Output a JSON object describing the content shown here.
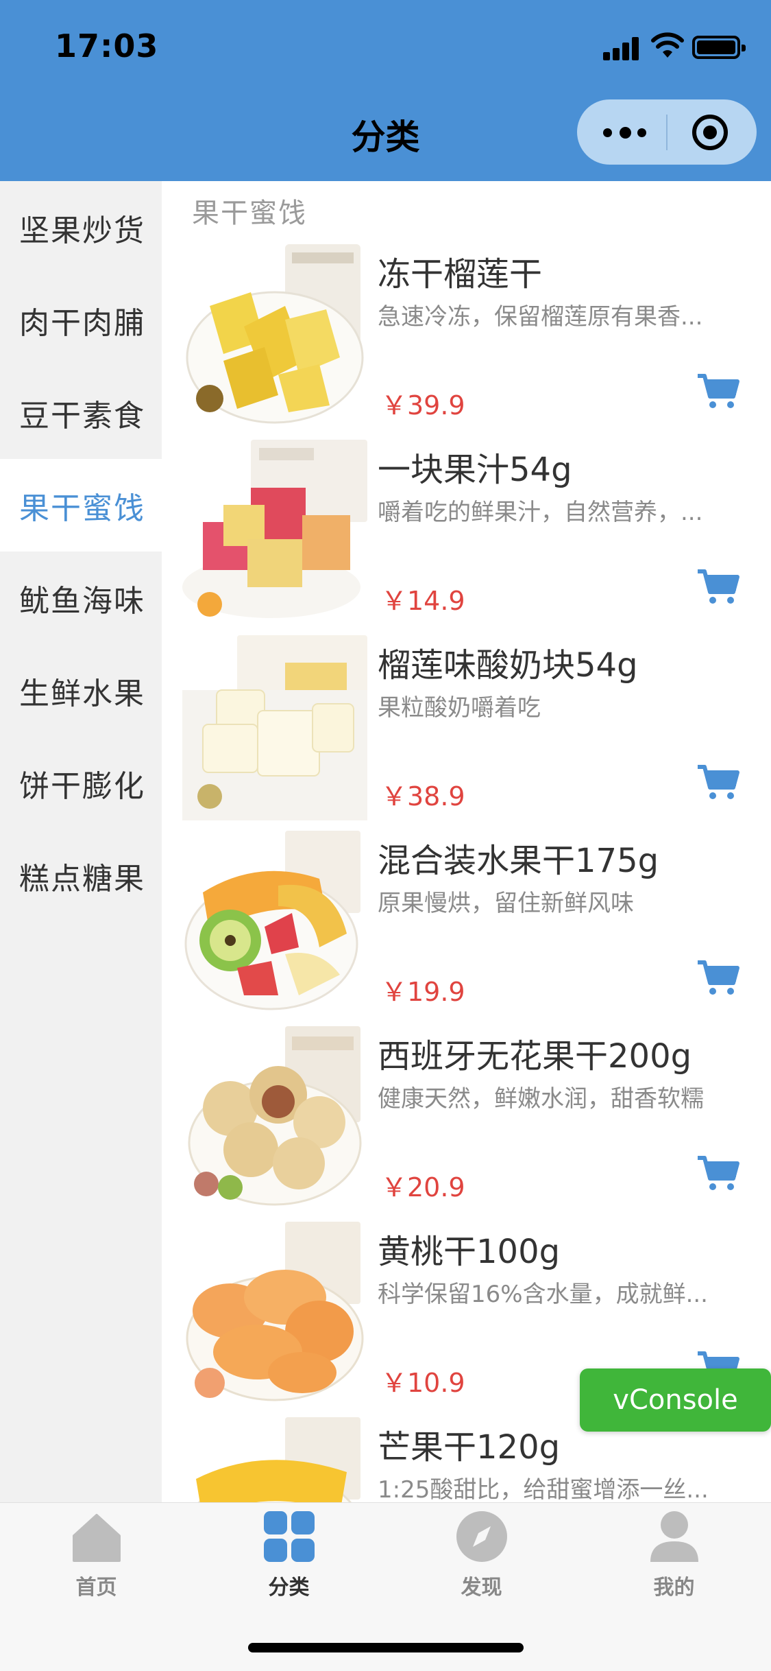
{
  "status_bar": {
    "time": "17:03"
  },
  "nav": {
    "title": "分类"
  },
  "colors": {
    "accent": "#4a90d5",
    "price": "#e0443f",
    "vconsole": "#40b63a"
  },
  "sidebar": {
    "items": [
      {
        "label": "坚果炒货",
        "active": false
      },
      {
        "label": "肉干肉脯",
        "active": false
      },
      {
        "label": "豆干素食",
        "active": false
      },
      {
        "label": "果干蜜饯",
        "active": true
      },
      {
        "label": "鱿鱼海味",
        "active": false
      },
      {
        "label": "生鲜水果",
        "active": false
      },
      {
        "label": "饼干膨化",
        "active": false
      },
      {
        "label": "糕点糖果",
        "active": false
      }
    ]
  },
  "section": {
    "title": "果干蜜饯"
  },
  "products": [
    {
      "name": "冻干榴莲干",
      "desc": "急速冷冻，保留榴莲原有果香...",
      "price": "￥39.9",
      "image": "durian-dried"
    },
    {
      "name": "一块果汁54g",
      "desc": "嚼着吃的鲜果汁，自然营养，...",
      "price": "￥14.9",
      "image": "fruit-juice-cubes"
    },
    {
      "name": "榴莲味酸奶块54g",
      "desc": "果粒酸奶嚼着吃",
      "price": "￥38.9",
      "image": "yogurt-cubes"
    },
    {
      "name": "混合装水果干175g",
      "desc": "原果慢烘，留住新鲜风味",
      "price": "￥19.9",
      "image": "mixed-dried-fruit"
    },
    {
      "name": "西班牙无花果干200g",
      "desc": "健康天然，鲜嫩水润，甜香软糯",
      "price": "￥20.9",
      "image": "dried-figs"
    },
    {
      "name": "黄桃干100g",
      "desc": "科学保留16%含水量，成就鲜...",
      "price": "￥10.9",
      "image": "dried-peach"
    },
    {
      "name": "芒果干120g",
      "desc": "1:25酸甜比，给甜蜜增添一丝...",
      "price": "",
      "image": "dried-mango"
    }
  ],
  "vconsole": {
    "label": "vConsole"
  },
  "tabbar": {
    "tabs": [
      {
        "label": "首页",
        "icon": "home-icon",
        "active": false
      },
      {
        "label": "分类",
        "icon": "category-grid-icon",
        "active": true
      },
      {
        "label": "发现",
        "icon": "compass-icon",
        "active": false
      },
      {
        "label": "我的",
        "icon": "person-icon",
        "active": false
      }
    ]
  }
}
